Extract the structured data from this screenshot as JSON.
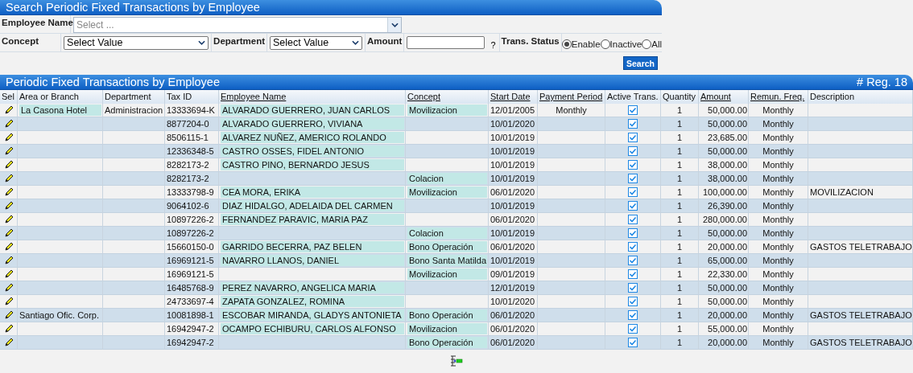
{
  "search_panel": {
    "title": "Search Periodic Fixed Transactions by Employee",
    "employee_name": {
      "label": "Employee Name",
      "placeholder": "Select ..."
    },
    "concept": {
      "label": "Concept",
      "value": "Select Value"
    },
    "department": {
      "label": "Department",
      "value": "Select Value"
    },
    "amount": {
      "label": "Amount",
      "help": "?"
    },
    "trans_status": {
      "label": "Trans. Status",
      "options": [
        {
          "label": "Enable",
          "selected": true
        },
        {
          "label": "Inactive",
          "selected": false
        },
        {
          "label": "All",
          "selected": false
        }
      ]
    },
    "search_button": "Search"
  },
  "results": {
    "title": "Periodic Fixed Transactions by Employee",
    "count": "# Reg. 18",
    "columns": [
      {
        "label": "Sel",
        "sortable": false
      },
      {
        "label": "Area or Branch",
        "sortable": false
      },
      {
        "label": "Department",
        "sortable": false
      },
      {
        "label": "Tax ID",
        "sortable": false
      },
      {
        "label": "Employee Name",
        "sortable": true
      },
      {
        "label": "Concept",
        "sortable": true
      },
      {
        "label": "Start Date",
        "sortable": true
      },
      {
        "label": "Payment Period",
        "sortable": true
      },
      {
        "label": "Active Trans.",
        "sortable": false
      },
      {
        "label": "Quantity",
        "sortable": false
      },
      {
        "label": "Amount",
        "sortable": true
      },
      {
        "label": "Remun. Freq.",
        "sortable": true
      },
      {
        "label": "Description",
        "sortable": false
      }
    ],
    "rows": [
      {
        "area": "La Casona Hotel",
        "area_highlight": true,
        "department": "Administracion",
        "tax_id": "13333694-K",
        "name": "ALVARADO GUERRERO, JUAN CARLOS",
        "concept": "Movilizacion",
        "start_date": "12/01/2005",
        "payment_period": "Monthly",
        "active": true,
        "quantity": "1",
        "amount": "50,000.00",
        "remun_freq": "Monthly"
      },
      {
        "tax_id": "8877204-0",
        "name": "ALVARADO GUERRERO, VIVIANA",
        "start_date": "10/01/2020",
        "active": true,
        "quantity": "1",
        "amount": "50,000.00",
        "remun_freq": "Monthly"
      },
      {
        "tax_id": "8506115-1",
        "name": "ALVAREZ NUÑEZ, AMERICO ROLANDO",
        "start_date": "10/01/2019",
        "active": true,
        "quantity": "1",
        "amount": "23,685.00",
        "remun_freq": "Monthly"
      },
      {
        "tax_id": "12336348-5",
        "name": "CASTRO OSSES, FIDEL ANTONIO",
        "start_date": "10/01/2019",
        "active": true,
        "quantity": "1",
        "amount": "50,000.00",
        "remun_freq": "Monthly"
      },
      {
        "tax_id": "8282173-2",
        "name": "CASTRO PINO, BERNARDO JESUS",
        "start_date": "10/01/2019",
        "active": true,
        "quantity": "1",
        "amount": "38,000.00",
        "remun_freq": "Monthly"
      },
      {
        "tax_id": "8282173-2",
        "concept": "Colacion",
        "start_date": "10/01/2019",
        "active": true,
        "quantity": "1",
        "amount": "38,000.00",
        "remun_freq": "Monthly"
      },
      {
        "tax_id": "13333798-9",
        "name": "CEA MORA, ERIKA",
        "concept": "Movilizacion",
        "start_date": "06/01/2020",
        "active": true,
        "quantity": "1",
        "amount": "100,000.00",
        "remun_freq": "Monthly",
        "description": "MOVILIZACION"
      },
      {
        "tax_id": "9064102-6",
        "name": "DIAZ HIDALGO, ADELAIDA DEL CARMEN",
        "start_date": "10/01/2019",
        "active": true,
        "quantity": "1",
        "amount": "26,390.00",
        "remun_freq": "Monthly"
      },
      {
        "tax_id": "10897226-2",
        "name": "FERNANDEZ PARAVIC, MARIA PAZ",
        "start_date": "06/01/2020",
        "active": true,
        "quantity": "1",
        "amount": "280,000.00",
        "remun_freq": "Monthly"
      },
      {
        "tax_id": "10897226-2",
        "concept": "Colacion",
        "start_date": "10/01/2019",
        "active": true,
        "quantity": "1",
        "amount": "50,000.00",
        "remun_freq": "Monthly"
      },
      {
        "tax_id": "15660150-0",
        "name": "GARRIDO BECERRA, PAZ BELEN",
        "concept": "Bono Operación",
        "start_date": "06/01/2020",
        "active": true,
        "quantity": "1",
        "amount": "20,000.00",
        "remun_freq": "Monthly",
        "description": "GASTOS TELETRABAJO"
      },
      {
        "tax_id": "16969121-5",
        "name": "NAVARRO LLANOS, DANIEL",
        "concept": "Bono Santa Matilda",
        "start_date": "10/01/2019",
        "active": true,
        "quantity": "1",
        "amount": "65,000.00",
        "remun_freq": "Monthly"
      },
      {
        "tax_id": "16969121-5",
        "concept": "Movilizacion",
        "start_date": "09/01/2019",
        "active": true,
        "quantity": "1",
        "amount": "22,330.00",
        "remun_freq": "Monthly"
      },
      {
        "tax_id": "16485768-9",
        "name": "PEREZ NAVARRO, ANGELICA MARIA",
        "start_date": "12/01/2019",
        "active": true,
        "quantity": "1",
        "amount": "50,000.00",
        "remun_freq": "Monthly"
      },
      {
        "tax_id": "24733697-4",
        "name": "ZAPATA GONZALEZ, ROMINA",
        "start_date": "10/01/2020",
        "active": true,
        "quantity": "1",
        "amount": "50,000.00",
        "remun_freq": "Monthly"
      },
      {
        "area": "Santiago Ofic. Corp.",
        "area_highlight": false,
        "tax_id": "10081898-1",
        "name": "ESCOBAR MIRANDA, GLADYS ANTONIETA",
        "concept": "Bono Operación",
        "start_date": "06/01/2020",
        "active": true,
        "quantity": "1",
        "amount": "20,000.00",
        "remun_freq": "Monthly",
        "description": "GASTOS TELETRABAJO"
      },
      {
        "tax_id": "16942947-2",
        "name": "OCAMPO ECHIBURU, CARLOS ALFONSO",
        "concept": "Movilizacion",
        "start_date": "06/01/2020",
        "active": true,
        "quantity": "1",
        "amount": "55,000.00",
        "remun_freq": "Monthly"
      },
      {
        "tax_id": "16942947-2",
        "concept": "Bono Operación",
        "start_date": "06/01/2020",
        "active": true,
        "quantity": "1",
        "amount": "20,000.00",
        "remun_freq": "Monthly",
        "description": "GASTOS TELETRABAJO"
      }
    ]
  }
}
